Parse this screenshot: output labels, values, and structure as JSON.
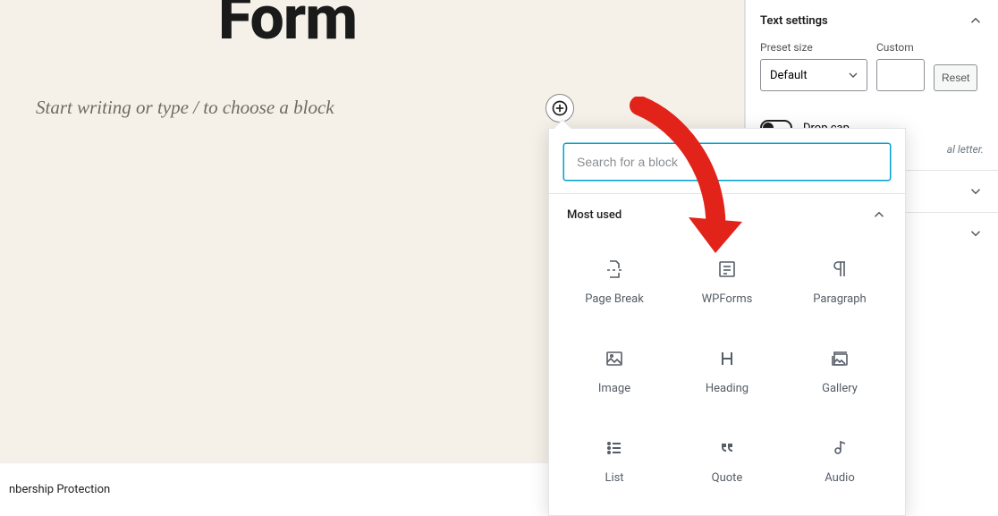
{
  "editor": {
    "page_title": "Form",
    "placeholder": "Start writing or type / to choose a block"
  },
  "inserter": {
    "search_placeholder": "Search for a block",
    "section_label": "Most used",
    "blocks": {
      "pagebreak": "Page Break",
      "wpforms": "WPForms",
      "paragraph": "Paragraph",
      "image": "Image",
      "heading": "Heading",
      "gallery": "Gallery",
      "list": "List",
      "quote": "Quote",
      "audio": "Audio"
    }
  },
  "sidebar": {
    "text_settings_label": "Text settings",
    "preset_label": "Preset size",
    "preset_value": "Default",
    "custom_label": "Custom",
    "custom_value": "",
    "reset_label": "Reset",
    "dropcap_label": "Drop cap",
    "dropcap_desc_tail": "al letter."
  },
  "bottom_bar": {
    "text": "nbership Protection"
  }
}
